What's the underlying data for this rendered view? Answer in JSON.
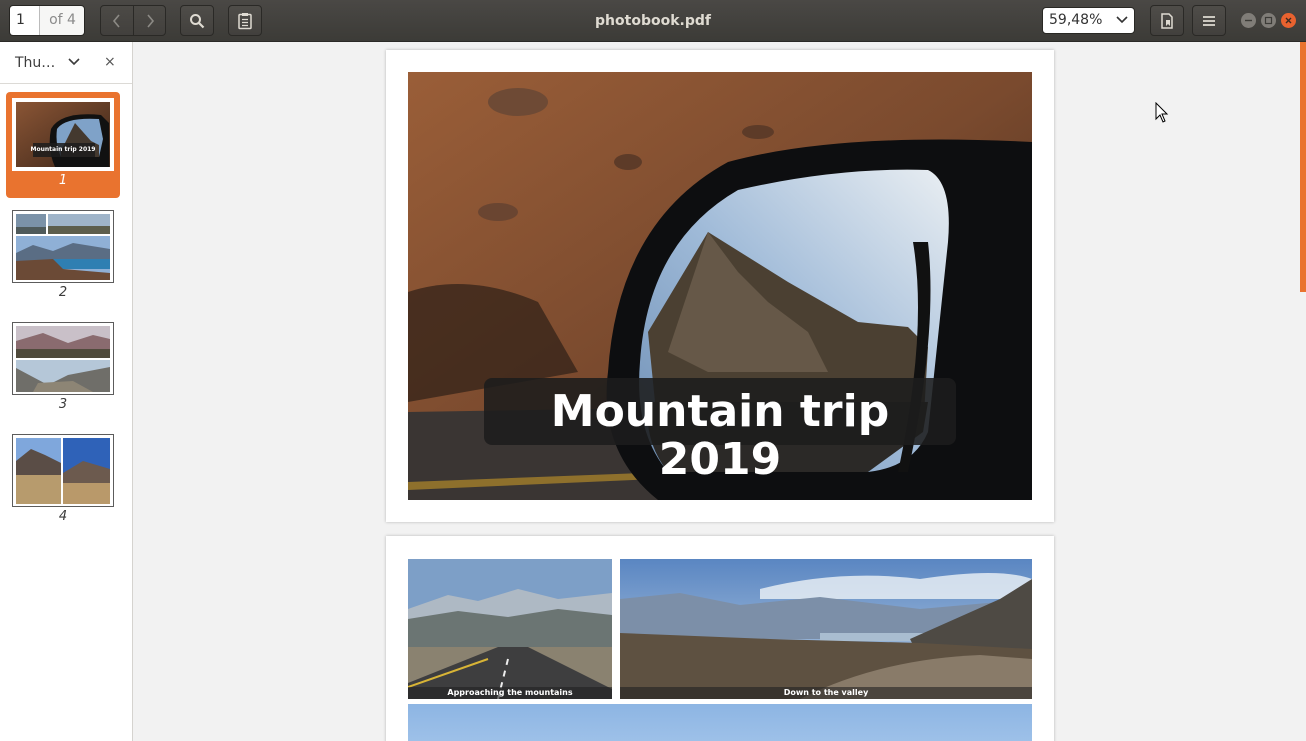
{
  "window": {
    "title": "photobook.pdf",
    "accent_color": "#e9732f"
  },
  "toolbar": {
    "page_current": "1",
    "page_total": "of 4",
    "prev_icon": "chevron-left-icon",
    "next_icon": "chevron-right-icon",
    "search_icon": "search-icon",
    "annotations_icon": "clipboard-icon",
    "zoom_value": "59,48%",
    "bookmark_icon": "document-bookmark-icon",
    "menu_icon": "hamburger-menu-icon"
  },
  "sidebar": {
    "mode_label": "Thu…",
    "close_label": "×",
    "thumbnails": [
      {
        "num": "1",
        "selected": true,
        "mini_caption": "Mountain trip 2019"
      },
      {
        "num": "2",
        "selected": false
      },
      {
        "num": "3",
        "selected": false
      },
      {
        "num": "4",
        "selected": false
      }
    ]
  },
  "pages": {
    "page1": {
      "title": "Mountain trip 2019"
    },
    "page2": {
      "caption_left": "Approaching the mountains",
      "caption_right": "Down to the valley"
    }
  }
}
